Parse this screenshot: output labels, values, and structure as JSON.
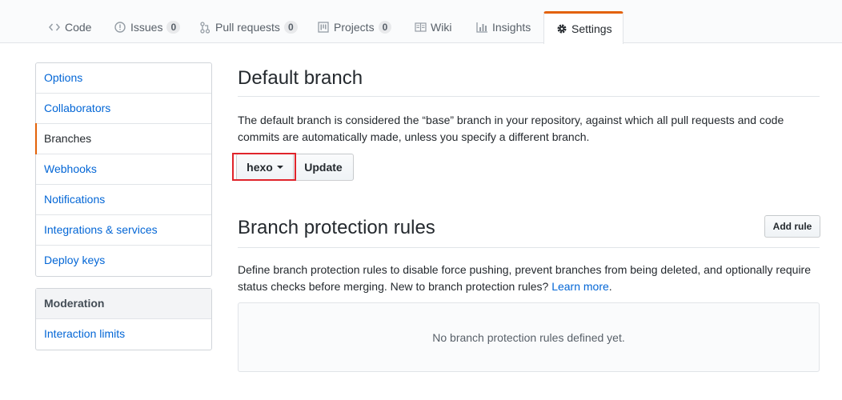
{
  "tabs": [
    {
      "label": "Code",
      "icon": "code-icon"
    },
    {
      "label": "Issues",
      "icon": "issue-icon",
      "count": "0"
    },
    {
      "label": "Pull requests",
      "icon": "pull-request-icon",
      "count": "0"
    },
    {
      "label": "Projects",
      "icon": "project-icon",
      "count": "0"
    },
    {
      "label": "Wiki",
      "icon": "book-icon"
    },
    {
      "label": "Insights",
      "icon": "graph-icon"
    },
    {
      "label": "Settings",
      "icon": "gear-icon",
      "selected": true
    }
  ],
  "sidebar": {
    "items": [
      {
        "label": "Options"
      },
      {
        "label": "Collaborators"
      },
      {
        "label": "Branches",
        "selected": true
      },
      {
        "label": "Webhooks"
      },
      {
        "label": "Notifications"
      },
      {
        "label": "Integrations & services"
      },
      {
        "label": "Deploy keys"
      }
    ],
    "moderation": {
      "heading": "Moderation",
      "items": [
        {
          "label": "Interaction limits"
        }
      ]
    }
  },
  "default_branch": {
    "title": "Default branch",
    "description": "The default branch is considered the “base” branch in your repository, against which all pull requests and code commits are automatically made, unless you specify a different branch.",
    "branch_select": "hexo",
    "update_label": "Update"
  },
  "protection": {
    "title": "Branch protection rules",
    "add_rule_label": "Add rule",
    "description": "Define branch protection rules to disable force pushing, prevent branches from being deleted, and optionally require status checks before merging. New to branch protection rules?",
    "learn_more": "Learn more",
    "period": ".",
    "empty_text": "No branch protection rules defined yet."
  },
  "colors": {
    "accent": "#e36209",
    "link": "#0366d6",
    "highlight_box": "#e0242b"
  }
}
